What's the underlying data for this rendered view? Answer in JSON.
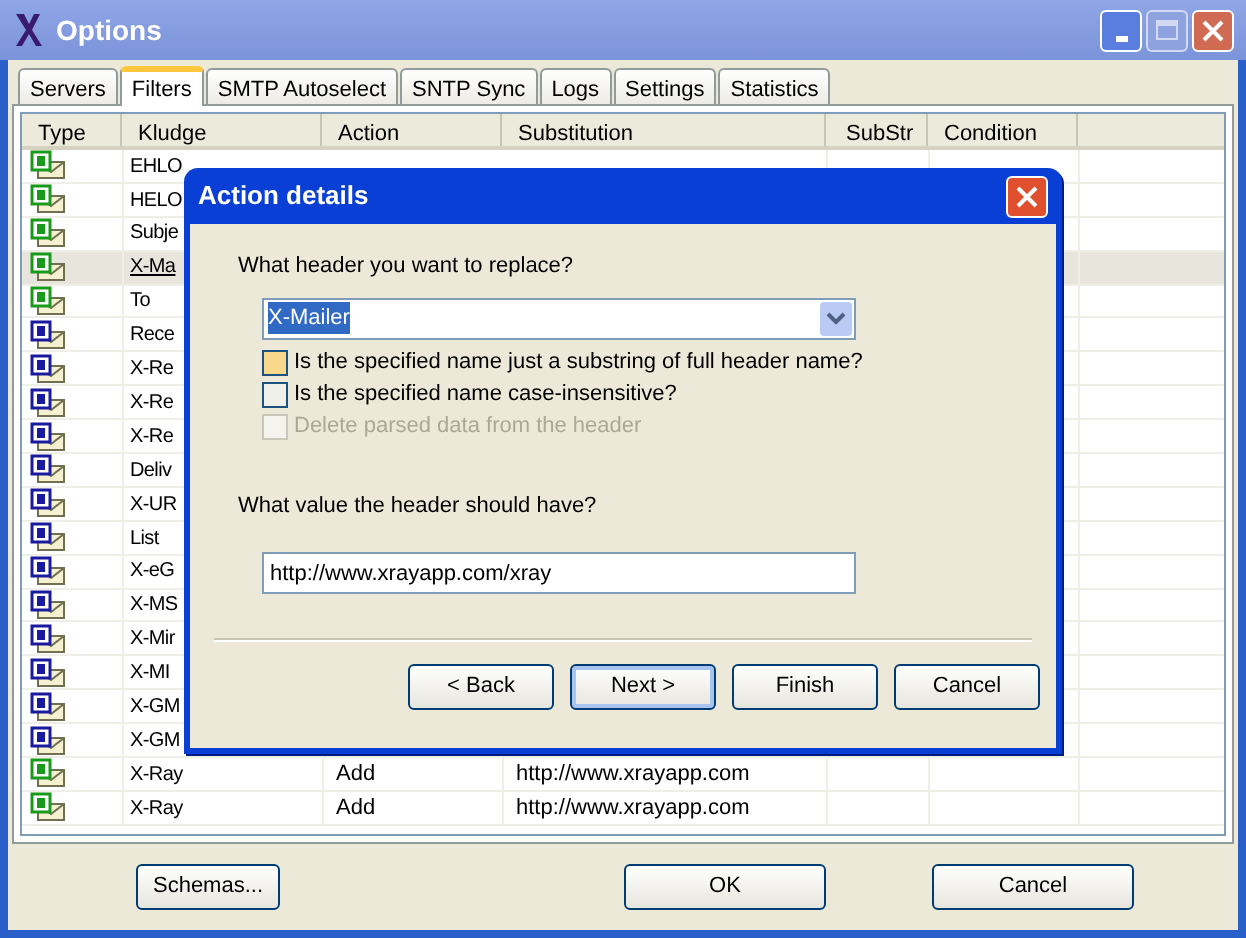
{
  "window": {
    "title": "Options"
  },
  "tabs": [
    {
      "label": "Servers",
      "selected": false
    },
    {
      "label": "Filters",
      "selected": true
    },
    {
      "label": "SMTP Autoselect",
      "selected": false
    },
    {
      "label": "SNTP Sync",
      "selected": false
    },
    {
      "label": "Logs",
      "selected": false
    },
    {
      "label": "Settings",
      "selected": false
    },
    {
      "label": "Statistics",
      "selected": false
    }
  ],
  "table": {
    "columns": [
      "Type",
      "Kludge",
      "Action",
      "Substitution",
      "SubStr",
      "Condition"
    ],
    "rows": [
      {
        "kind": "s",
        "kludge": "EHLO",
        "selected": false
      },
      {
        "kind": "s",
        "kludge": "HELO",
        "selected": false
      },
      {
        "kind": "s",
        "kludge": "Subje",
        "selected": false
      },
      {
        "kind": "s",
        "kludge": "X-Ma",
        "selected": true
      },
      {
        "kind": "s",
        "kludge": "To",
        "selected": false
      },
      {
        "kind": "p",
        "kludge": "Rece",
        "selected": false
      },
      {
        "kind": "p",
        "kludge": "X-Re",
        "selected": false
      },
      {
        "kind": "p",
        "kludge": "X-Re",
        "selected": false
      },
      {
        "kind": "p",
        "kludge": "X-Re",
        "selected": false
      },
      {
        "kind": "p",
        "kludge": "Deliv",
        "selected": false
      },
      {
        "kind": "p",
        "kludge": "X-UR",
        "selected": false
      },
      {
        "kind": "p",
        "kludge": "List",
        "selected": false
      },
      {
        "kind": "p",
        "kludge": "X-eG",
        "selected": false
      },
      {
        "kind": "p",
        "kludge": "X-MS",
        "selected": false
      },
      {
        "kind": "p",
        "kludge": "X-Mir",
        "selected": false
      },
      {
        "kind": "p",
        "kludge": "X-MI",
        "selected": false
      },
      {
        "kind": "p",
        "kludge": "X-GM",
        "selected": false
      },
      {
        "kind": "p",
        "kludge": "X-GM",
        "selected": false
      },
      {
        "kind": "s",
        "kludge": "X-Ray",
        "action": "Add",
        "substitution": "http://www.xrayapp.com",
        "selected": false
      },
      {
        "kind": "s",
        "kludge": "X-Ray",
        "action": "Add",
        "substitution": "http://www.xrayapp.com",
        "selected": false
      }
    ]
  },
  "buttons": [
    "Schemas...",
    "OK",
    "Cancel"
  ],
  "dialog": {
    "title": "Action details",
    "header_label": "What header you want to replace?",
    "header_value": "X-Mailer",
    "options": [
      {
        "label": "Is the specified name just a substring of full header name?",
        "checked": false,
        "disabled": false,
        "hover": true
      },
      {
        "label": "Is the specified name case-insensitive?",
        "checked": false,
        "disabled": false,
        "hover": false
      },
      {
        "label": "Delete parsed data from the header",
        "checked": false,
        "disabled": true,
        "hover": false
      }
    ],
    "value_label": "What value the header should have?",
    "value": "http://www.xrayapp.com/xray",
    "buttons": [
      {
        "label": "< Back",
        "selected": false
      },
      {
        "label": "Next >",
        "selected": true
      },
      {
        "label": "Finish",
        "selected": false
      },
      {
        "label": "Cancel",
        "selected": false
      }
    ]
  }
}
